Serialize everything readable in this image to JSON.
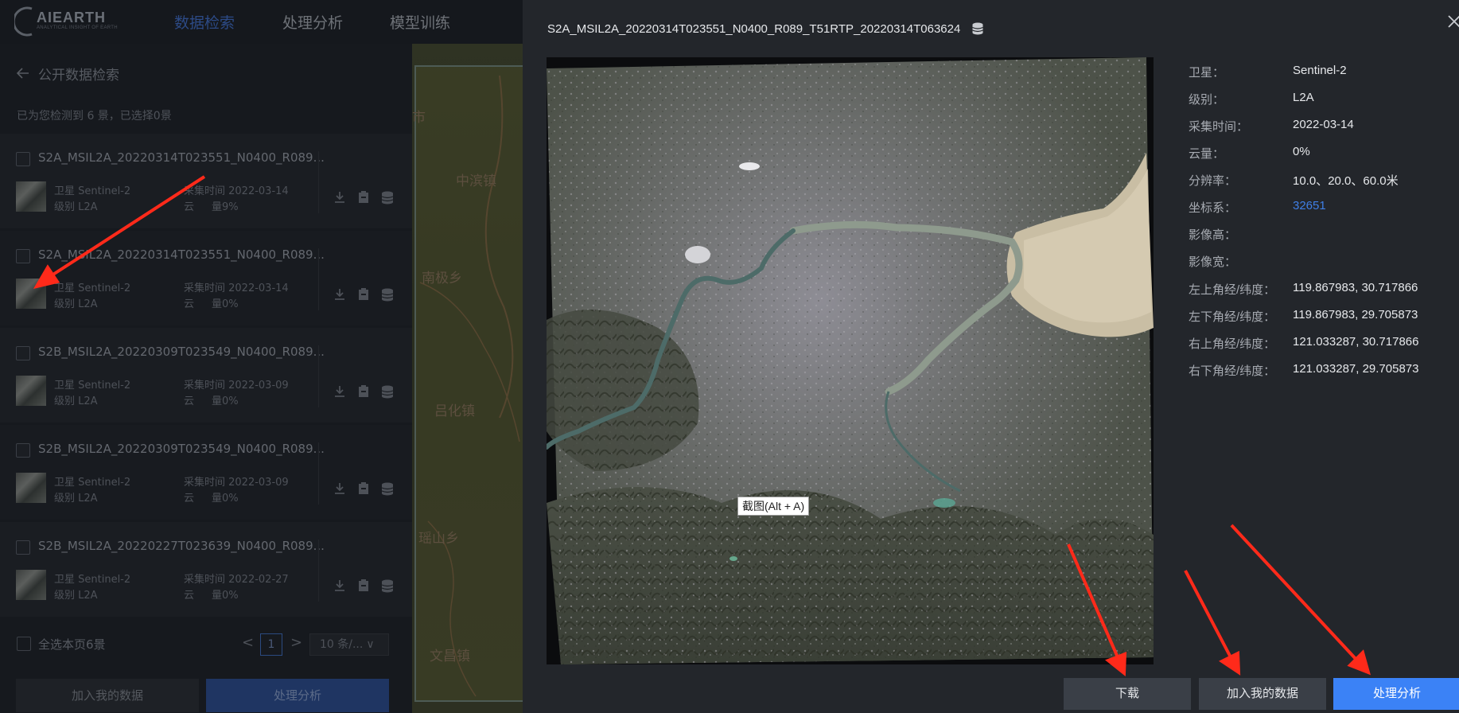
{
  "navbar": {
    "logo_text": "AIEARTH",
    "logo_sub": "ANALYTICAL INSIGHT OF EARTH",
    "tabs": [
      {
        "label": "数据检索",
        "active": true
      },
      {
        "label": "处理分析",
        "active": false
      },
      {
        "label": "模型训练",
        "active": false
      }
    ]
  },
  "search_panel": {
    "title": "公开数据检索",
    "count_text": "已为您检测到 6 景，已选择0景",
    "results": [
      {
        "name": "S2A_MSIL2A_20220314T023551_N0400_R089...",
        "satellite": "卫星 Sentinel-2",
        "level": "级别 L2A",
        "date": "采集时间 2022-03-14",
        "cloud_label": "云",
        "cloud": "量9%"
      },
      {
        "name": "S2A_MSIL2A_20220314T023551_N0400_R089...",
        "satellite": "卫星 Sentinel-2",
        "level": "级别 L2A",
        "date": "采集时间 2022-03-14",
        "cloud_label": "云",
        "cloud": "量0%"
      },
      {
        "name": "S2B_MSIL2A_20220309T023549_N0400_R089...",
        "satellite": "卫星 Sentinel-2",
        "level": "级别 L2A",
        "date": "采集时间 2022-03-09",
        "cloud_label": "云",
        "cloud": "量0%"
      },
      {
        "name": "S2B_MSIL2A_20220309T023549_N0400_R089...",
        "satellite": "卫星 Sentinel-2",
        "level": "级别 L2A",
        "date": "采集时间 2022-03-09",
        "cloud_label": "云",
        "cloud": "量0%"
      },
      {
        "name": "S2B_MSIL2A_20220227T023639_N0400_R089...",
        "satellite": "卫星 Sentinel-2",
        "level": "级别 L2A",
        "date": "采集时间 2022-02-27",
        "cloud_label": "云",
        "cloud": "量0%"
      }
    ],
    "select_all_label": "全选本页6景",
    "pager": {
      "prev": "<",
      "page": "1",
      "next": ">",
      "page_size": "10 条/..."
    },
    "add_button": "加入我的数据",
    "process_button": "处理分析"
  },
  "map": {
    "labels": [
      "市",
      "中滨镇",
      "南极乡",
      "吕化镇",
      "瑶山乡",
      "文昌镇"
    ]
  },
  "detail_modal": {
    "title": "S2A_MSIL2A_20220314T023551_N0400_R089_T51RTP_20220314T063624",
    "screenshot_tip": "截图(Alt + A)",
    "info": [
      {
        "label": "卫星：",
        "value": "Sentinel-2"
      },
      {
        "label": "级别：",
        "value": "L2A"
      },
      {
        "label": "采集时间：",
        "value": "2022-03-14"
      },
      {
        "label": "云量：",
        "value": "0%"
      },
      {
        "label": "分辨率：",
        "value": "10.0、20.0、60.0米"
      },
      {
        "label": "坐标系：",
        "value": "32651",
        "link": true
      },
      {
        "label": "影像高：",
        "value": ""
      },
      {
        "label": "影像宽：",
        "value": ""
      },
      {
        "label": "左上角经/纬度：",
        "value": "119.867983, 30.717866"
      },
      {
        "label": "左下角经/纬度：",
        "value": "119.867983, 29.705873"
      },
      {
        "label": "右上角经/纬度：",
        "value": "121.033287, 30.717866"
      },
      {
        "label": "右下角经/纬度：",
        "value": "121.033287, 29.705873"
      }
    ],
    "buttons": {
      "download": "下载",
      "add": "加入我的数据",
      "process": "处理分析"
    }
  },
  "colors": {
    "accent": "#3b82f6",
    "link": "#3f7fe6",
    "annotation_arrow": "#ff2a1a",
    "modal_bg": "#23262b",
    "overlay_bg": "#15181d"
  }
}
